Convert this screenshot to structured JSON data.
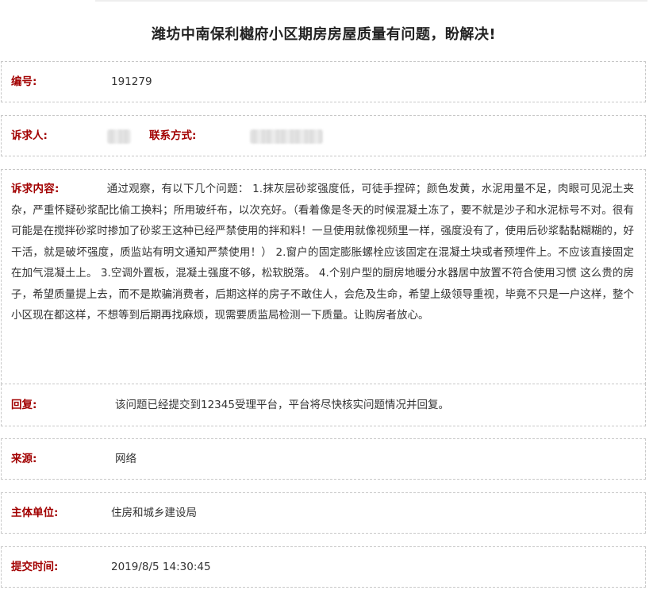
{
  "title": "潍坊中南保利樾府小区期房房屋质量有问题，盼解决!",
  "fields": {
    "number": {
      "label": "编号:",
      "value": "191279"
    },
    "complainant": {
      "label": "诉求人:",
      "contact_label": "联系方式:"
    },
    "content": {
      "label": "诉求内容:",
      "value": "通过观察，有以下几个问题： 1.抹灰层砂浆强度低，可徒手捏碎；颜色发黄，水泥用量不足，肉眼可见泥土夹杂，严重怀疑砂浆配比偷工换料；所用玻纤布，以次充好。（看着像是冬天的时候混凝土冻了，要不就是沙子和水泥标号不对。很有可能是在搅拌砂浆时掺加了砂浆王这种已经严禁使用的拌和料！一旦使用就像视频里一样，强度没有了，使用后砂浆黏黏糊糊的，好干活，就是破坏强度，质监站有明文通知严禁使用！） 2.窗户的固定膨胀螺栓应该固定在混凝土块或者预埋件上。不应该直接固定在加气混凝土上。 3.空调外置板，混凝土强度不够，松软脱落。 4.个别户型的厨房地暖分水器居中放置不符合使用习惯 这么贵的房子，希望质量提上去，而不是欺骗消费者，后期这样的房子不敢住人，会危及生命，希望上级领导重视，毕竟不只是一户这样，整个小区现在都这样，不想等到后期再找麻烦，现需要质监局检测一下质量。让购房者放心。"
    },
    "reply": {
      "label": "回复:",
      "value": "该问题已经提交到12345受理平台，平台将尽快核实问题情况并回复。"
    },
    "source": {
      "label": "来源:",
      "value": "网络"
    },
    "unit": {
      "label": "主体单位:",
      "value": "住房和城乡建设局"
    },
    "time": {
      "label": "提交时间:",
      "value": "2019/8/5 14:30:45"
    }
  },
  "colors": {
    "label": "#a20000",
    "text": "#333333",
    "border": "#c8c8c8"
  }
}
